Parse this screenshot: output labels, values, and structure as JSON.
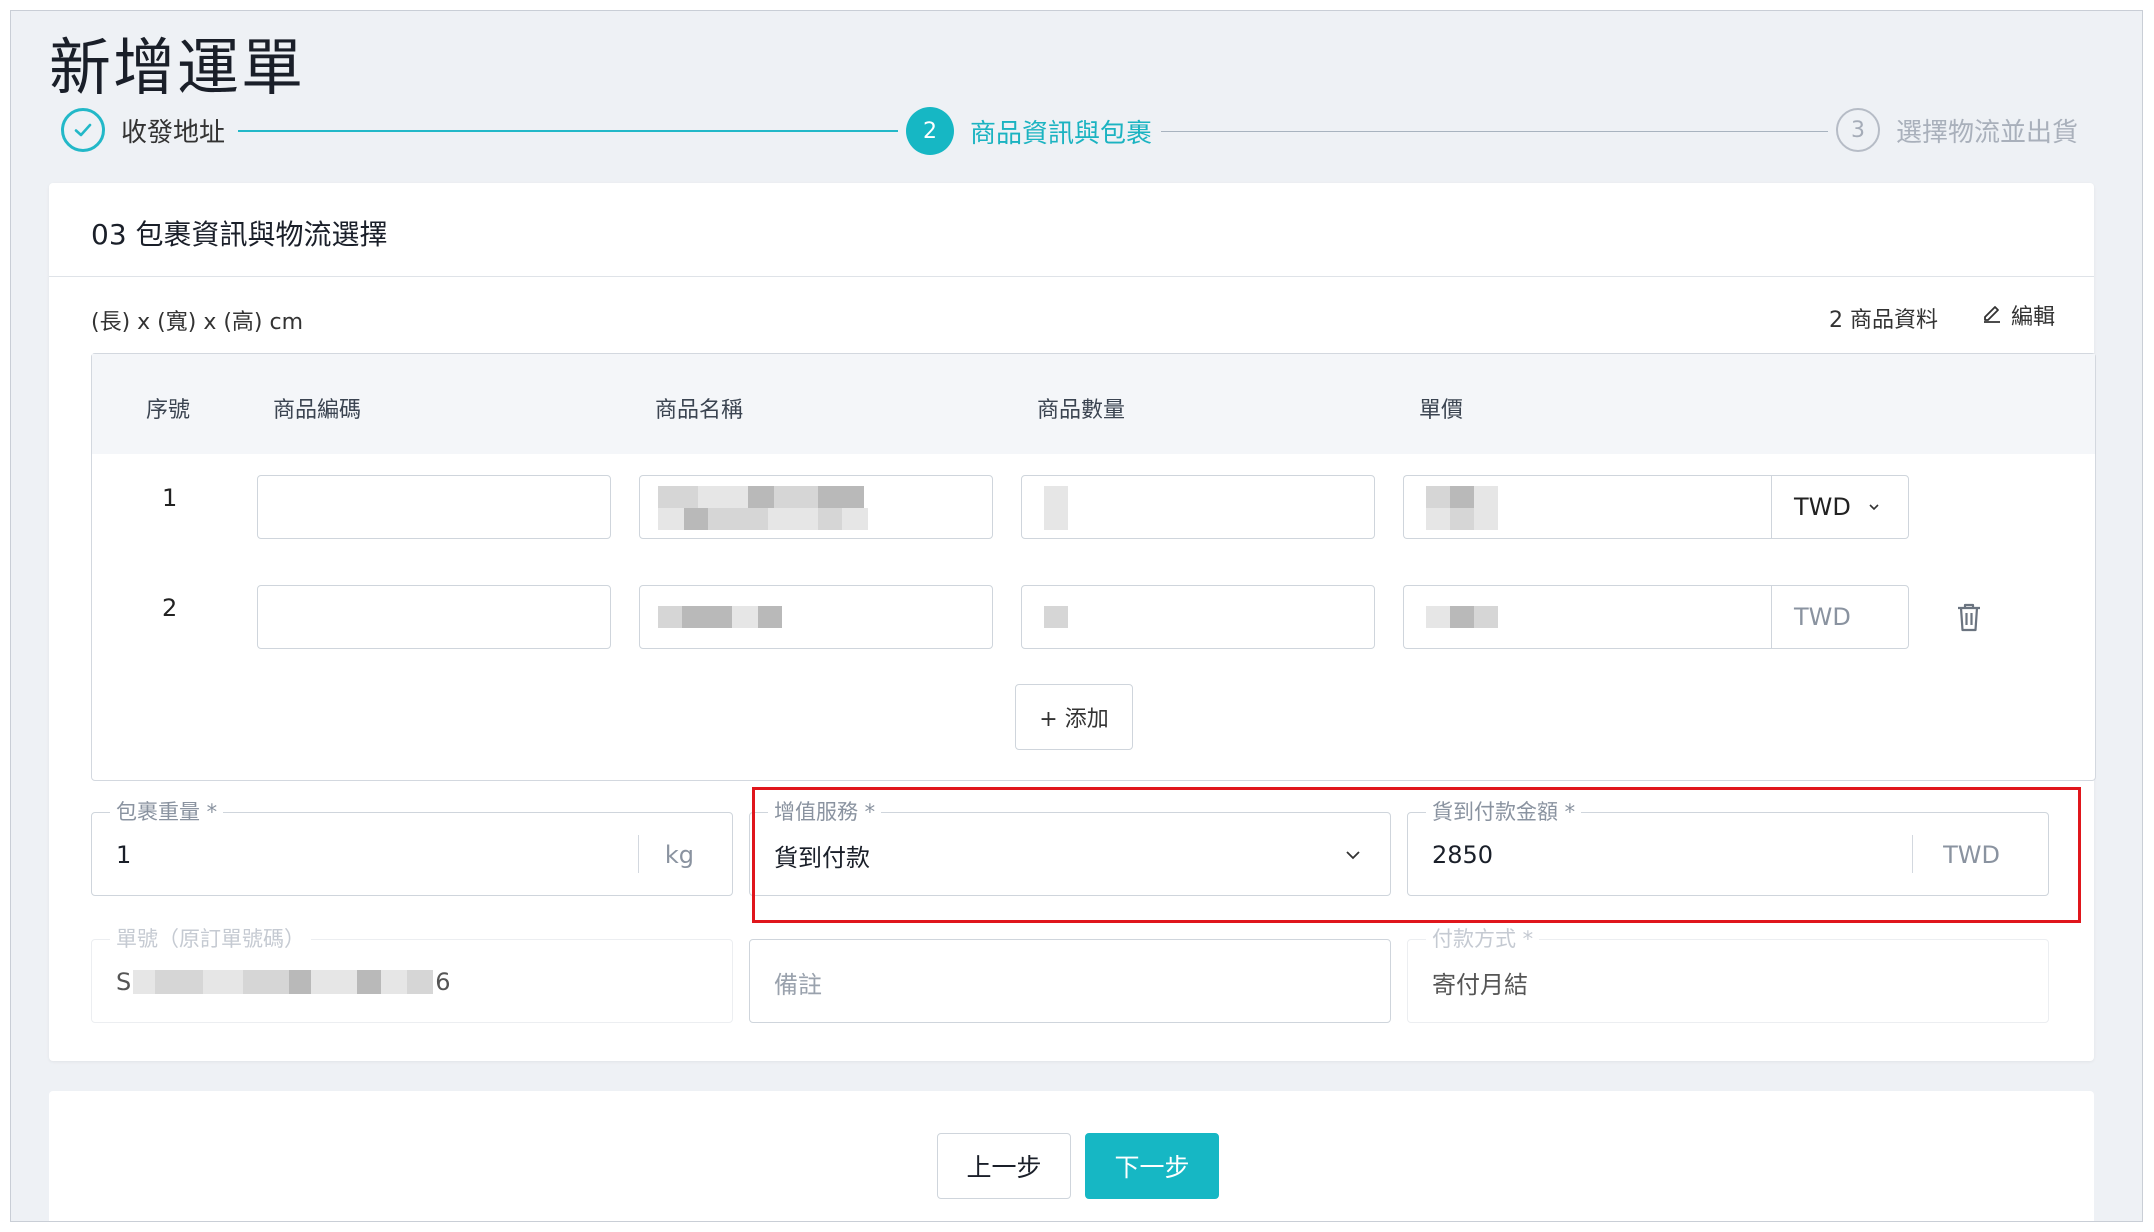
{
  "page": {
    "title": "新增運單"
  },
  "stepper": {
    "steps": [
      {
        "label": "收發地址",
        "state": "done",
        "icon": "check-icon"
      },
      {
        "number": "2",
        "label": "商品資訊與包裹",
        "state": "active"
      },
      {
        "number": "3",
        "label": "選擇物流並出貨",
        "state": "pending"
      }
    ]
  },
  "package": {
    "title": "03 包裹資訊與物流選擇",
    "dims_label": "(長) x (寬) x (高) cm",
    "items_count": "2 商品資料",
    "edit_label": "編輯"
  },
  "items_table": {
    "headers": [
      "序號",
      "商品編碼",
      "商品名稱",
      "商品數量",
      "單價"
    ],
    "rows": [
      {
        "index": "1",
        "code": "",
        "currency": "TWD"
      },
      {
        "index": "2",
        "code": "",
        "currency": "TWD"
      }
    ],
    "add_label": "+ 添加"
  },
  "fields": {
    "weight": {
      "label": "包裹重量 *",
      "value": "1",
      "unit": "kg"
    },
    "value_added_service": {
      "label": "增值服務 *",
      "value": "貨到付款"
    },
    "cod_amount": {
      "label": "貨到付款金額 *",
      "value": "2850",
      "unit": "TWD"
    },
    "order_no": {
      "label": "單號（原訂單號碼）",
      "value_prefix": "S",
      "value_suffix": "6"
    },
    "remark": {
      "placeholder": "備註"
    },
    "payment_method": {
      "label": "付款方式 *",
      "value": "寄付月結"
    }
  },
  "footer": {
    "prev_label": "上一步",
    "next_label": "下一步"
  },
  "colors": {
    "accent": "#16b7c4",
    "highlight": "#e0161c"
  }
}
